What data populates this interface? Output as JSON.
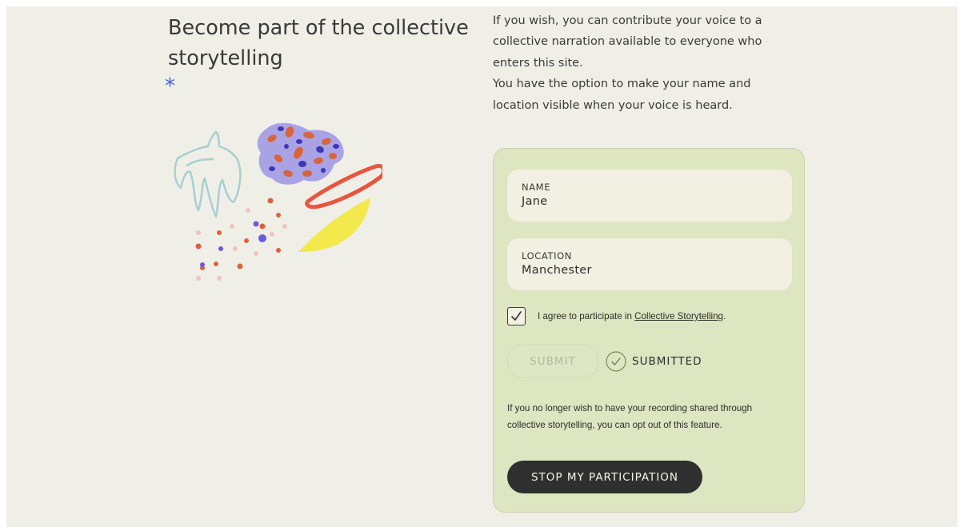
{
  "header": {
    "title": "Become part of the collective storytelling",
    "asterisk": "*"
  },
  "intro": {
    "paragraph_1": "If you wish, you can contribute your voice to a collective narration available to everyone who enters this site.",
    "paragraph_2": "You have the option to make your name and location visible when your voice is heard."
  },
  "form": {
    "name": {
      "label": "NAME",
      "value": "Jane"
    },
    "location": {
      "label": "LOCATION",
      "value": "Manchester"
    },
    "consent": {
      "checked": true,
      "text": "I agree to participate in ",
      "link": "Collective Storytelling",
      "suffix": "."
    },
    "submit_label": "SUBMIT",
    "submitted_label": "SUBMITTED",
    "optout_text": "If you no longer wish to have your recording shared through collective storytelling, you can opt out of this feature.",
    "stop_label": "STOP MY PARTICIPATION"
  },
  "colors": {
    "page_background": "#efefe8",
    "card_background": "#dde5c1",
    "accent_blue": "#3f63d9",
    "button_dark": "#2f2f2f"
  },
  "icons": [
    "asterisk-icon",
    "checkmark-icon",
    "check-circle-icon",
    "decorative-illustration"
  ]
}
